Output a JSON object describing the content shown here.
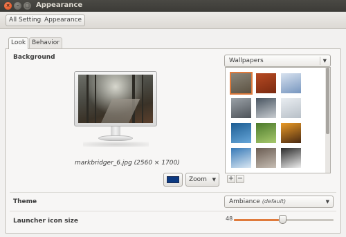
{
  "window": {
    "title": "Appearance",
    "close_glyph": "×",
    "min_glyph": "–",
    "max_glyph": "□"
  },
  "breadcrumb": {
    "items": [
      "All Settings",
      "Appearance"
    ]
  },
  "tabs": [
    {
      "label": "Look",
      "active": true
    },
    {
      "label": "Behavior",
      "active": false
    }
  ],
  "background": {
    "section_label": "Background",
    "caption": "markbridger_6.jpg (2560 × 1700)",
    "color": "#0c3a82",
    "zoom_label": "Zoom",
    "source_label": "Wallpapers",
    "thumb_count": 12,
    "add_glyph": "+",
    "remove_glyph": "−",
    "thumb_colors": [
      [
        "#8a8579",
        "#5c5242"
      ],
      [
        "#b74a23",
        "#7a2a10"
      ],
      [
        "#d8e2ef",
        "#7796bf"
      ],
      [
        "#9aa1a7",
        "#4d5258"
      ],
      [
        "#495561",
        "#c9cdd1"
      ],
      [
        "#e9edf1",
        "#b8c0c8"
      ],
      [
        "#1c5d93",
        "#67a6d8"
      ],
      [
        "#4c7a2c",
        "#a8c96d"
      ],
      [
        "#e99a27",
        "#4a2a12"
      ],
      [
        "#3679b6",
        "#d9e7f3"
      ],
      [
        "#6a5c52",
        "#c7beb4"
      ],
      [
        "#2a2a2a",
        "#eeeeee"
      ]
    ]
  },
  "theme": {
    "label": "Theme",
    "value": "Ambiance",
    "note": "(default)"
  },
  "launcher": {
    "label": "Launcher icon size",
    "value": "48",
    "fraction": 0.45
  },
  "icons": {
    "close": "close-icon",
    "dropdown": "chevron-down-icon"
  },
  "colors": {
    "accent": "#df7a3b",
    "titlebar": "#3c3b37"
  }
}
